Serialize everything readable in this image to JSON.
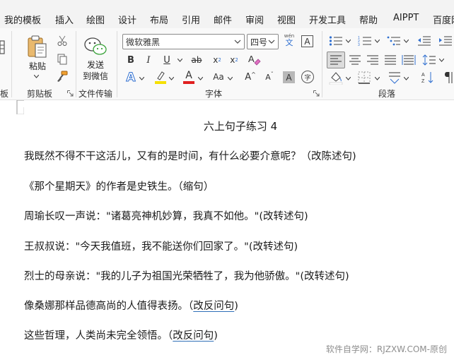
{
  "tabs": [
    "我的模板",
    "插入",
    "绘图",
    "设计",
    "布局",
    "引用",
    "邮件",
    "审阅",
    "视图",
    "开发工具",
    "帮助",
    "AIPPT",
    "百度网"
  ],
  "clipboard": {
    "paste_label": "粘贴",
    "group_label": "剪贴板"
  },
  "file_transfer": {
    "send_label_line1": "发送",
    "send_label_line2": "到微信",
    "group_label": "文件传输"
  },
  "font": {
    "font_name": "微软雅黑",
    "font_size": "四号",
    "pinyin_top": "wén",
    "pinyin_char": "文",
    "border_char": "A",
    "bold": "B",
    "italic": "I",
    "underline": "U",
    "strike": "ab",
    "subscript": "x",
    "subscript_mark": "2",
    "superscript": "x",
    "superscript_mark": "2",
    "text_effect": "A",
    "highlight": "A",
    "font_color": "A",
    "change_case": "Aa",
    "grow": "A",
    "shrink": "A",
    "shade": "A",
    "encircle": "字",
    "group_label": "字体",
    "highlight_color": "#f5e000",
    "font_color_value": "#e02020",
    "effect_color": "#2f6fd0"
  },
  "paragraph": {
    "group_label": "段落"
  },
  "side_left": {
    "left_partial_label": "板"
  },
  "document": {
    "title": "六上句子练习 4",
    "lines": [
      "我既然不得不干这活儿，又有的是时间，有什么必要介意呢？（改陈述句)",
      "《那个星期天》的作者是史铁生。（缩句）",
      "周瑜长叹一声说：\"诸葛亮神机妙算，我真不如他。\"(改转述句)",
      "王叔叔说：\"今天我值班，我不能送你们回家了。\"(改转述句)",
      "烈士的母亲说：\"我的儿子为祖国光荣牺牲了，我为他骄傲。\"(改转述句)"
    ],
    "line6_main": "像桑娜那样品德高尚的人值得表扬。（",
    "line6_mark": "改反问句",
    "line6_end": ")",
    "line7_main": "这些哲理，人类尚未完全领悟。（",
    "line7_mark": "改反问句",
    "line7_end": ")"
  },
  "watermark": "软件自学网：RJZXW.COM-原创"
}
